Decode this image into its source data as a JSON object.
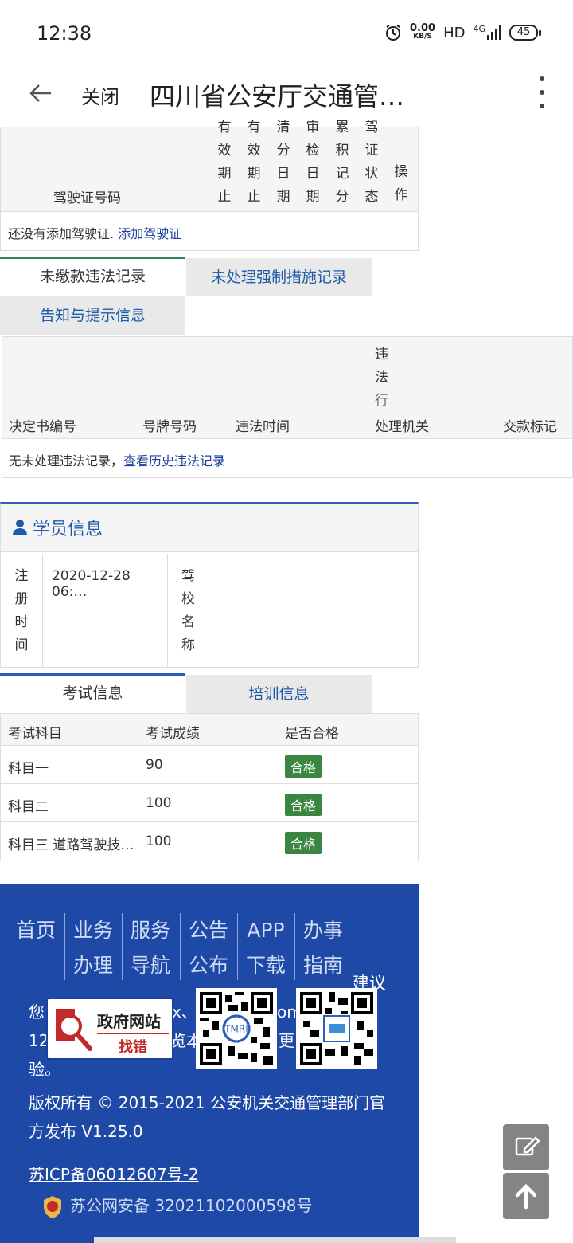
{
  "status_bar": {
    "time": "12:38",
    "speed_top": "0.00",
    "speed_unit": "KB/S",
    "hd": "HD",
    "network": "4G",
    "battery": "45"
  },
  "navbar": {
    "close_label": "关闭",
    "title": "四川省公安厅交通管…"
  },
  "license_table": {
    "columns": [
      "有效期止",
      "有效期止",
      "清分日期",
      "审检日期",
      "累积记分",
      "驾证状态",
      "操作"
    ],
    "column_visible": [
      [
        "效",
        "期",
        "止"
      ],
      [
        "效",
        "期",
        "止"
      ],
      [
        "分",
        "日",
        "期"
      ],
      [
        "检",
        "日",
        "期"
      ],
      [
        "积",
        "记",
        "分"
      ],
      [
        "证",
        "状",
        "态"
      ],
      [
        "操",
        "作"
      ]
    ],
    "col0_label": "驾驶证号码",
    "empty_text": "还没有添加驾驶证. ",
    "empty_link": "添加驾驶证"
  },
  "violation_tabs": [
    {
      "label": "未缴款违法记录",
      "active": true
    },
    {
      "label": "未处理强制措施记录",
      "active": false
    },
    {
      "label": "告知与提示信息",
      "active": false
    }
  ],
  "violation_table": {
    "headers": [
      "决定书编号",
      "号牌号码",
      "违法时间",
      "违法行为",
      "处理机关",
      "交款标记"
    ],
    "stacked_chars": [
      "违",
      "法",
      "行"
    ],
    "mixed_header": "处理机关",
    "empty_text": "无未处理违法记录，",
    "empty_link": "查看历史违法记录"
  },
  "student_panel": {
    "title": "学员信息",
    "reg_label_chars": [
      "注",
      "册",
      "时",
      "间"
    ],
    "reg_value": "2020-12-28 06:…",
    "school_label_chars": [
      "驾",
      "校",
      "名",
      "称"
    ],
    "school_value": ""
  },
  "exam_tabs": [
    {
      "label": "考试信息",
      "active": true
    },
    {
      "label": "培训信息",
      "active": false
    }
  ],
  "exam_table": {
    "headers": [
      "考试科目",
      "考试成绩",
      "是否合格"
    ],
    "rows": [
      {
        "subject": "科目一",
        "score": "90",
        "result": "合格"
      },
      {
        "subject": "科目二",
        "score": "100",
        "result": "合格"
      },
      {
        "subject": "科目三 道路驾驶技…",
        "score": "100",
        "result": "合格"
      }
    ],
    "pass_color": "#3a8540"
  },
  "footer": {
    "nav_top": [
      "首页",
      "业务",
      "服务",
      "公告",
      "APP",
      "办事"
    ],
    "nav_bottom": [
      "办理",
      "导航",
      "公布",
      "下载",
      "指南"
    ],
    "suggest": "建议",
    "text_line1": "您",
    "text_line2_left": "12",
    "text_line2_right": "更",
    "text_line3": "验。",
    "partial_x": "x、",
    "partial_om": "om",
    "partial_ben": "览本",
    "gov_badge_top": "政府网站",
    "gov_badge_bottom": "找错",
    "copyright": "版权所有 © 2015-2021 公安机关交通管理部门官方发布 V1.25.0",
    "icp": "苏ICP备06012607号-2",
    "police_record": "苏公网安备 32021102000598号",
    "bg_color": "#1f49a6"
  },
  "fab": {
    "edit_icon": "edit-icon",
    "top_icon": "arrow-up-icon"
  }
}
